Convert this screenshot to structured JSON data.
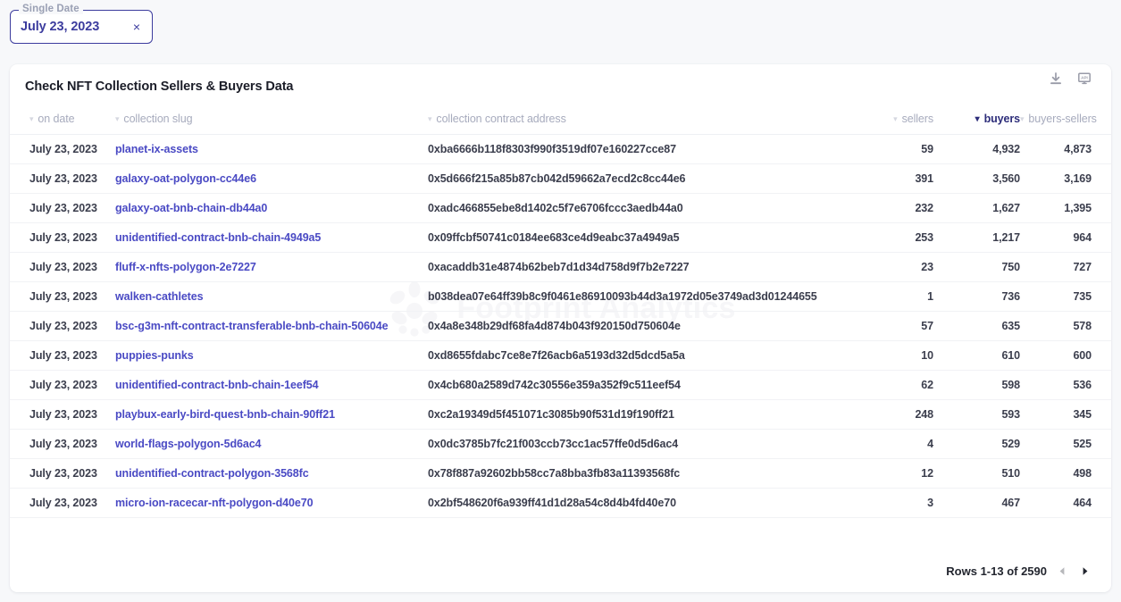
{
  "date_filter": {
    "legend": "Single Date",
    "value": "July 23, 2023",
    "clear_label": "×"
  },
  "card": {
    "title": "Check NFT Collection Sellers & Buyers Data",
    "actions": [
      {
        "name": "download-icon",
        "label": "download"
      },
      {
        "name": "api-icon",
        "label": "api"
      }
    ]
  },
  "watermark": {
    "text": "Footprint Analytics"
  },
  "table": {
    "columns": [
      {
        "key": "on_date",
        "label": "on date",
        "sorted": false
      },
      {
        "key": "collection_slug",
        "label": "collection slug",
        "sorted": false
      },
      {
        "key": "collection_contract_address",
        "label": "collection contract address",
        "sorted": false
      },
      {
        "key": "sellers",
        "label": "sellers",
        "sorted": false
      },
      {
        "key": "buyers",
        "label": "buyers",
        "sorted": true
      },
      {
        "key": "buyers_sellers",
        "label": "buyers-sellers",
        "sorted": false
      }
    ],
    "rows": [
      {
        "on_date": "July 23, 2023",
        "slug": "planet-ix-assets",
        "address": "0xba6666b118f8303f990f3519df07e160227cce87",
        "sellers": "59",
        "buyers": "4,932",
        "buyers_sellers": "4,873"
      },
      {
        "on_date": "July 23, 2023",
        "slug": "galaxy-oat-polygon-cc44e6",
        "address": "0x5d666f215a85b87cb042d59662a7ecd2c8cc44e6",
        "sellers": "391",
        "buyers": "3,560",
        "buyers_sellers": "3,169"
      },
      {
        "on_date": "July 23, 2023",
        "slug": "galaxy-oat-bnb-chain-db44a0",
        "address": "0xadc466855ebe8d1402c5f7e6706fccc3aedb44a0",
        "sellers": "232",
        "buyers": "1,627",
        "buyers_sellers": "1,395"
      },
      {
        "on_date": "July 23, 2023",
        "slug": "unidentified-contract-bnb-chain-4949a5",
        "address": "0x09ffcbf50741c0184ee683ce4d9eabc37a4949a5",
        "sellers": "253",
        "buyers": "1,217",
        "buyers_sellers": "964"
      },
      {
        "on_date": "July 23, 2023",
        "slug": "fluff-x-nfts-polygon-2e7227",
        "address": "0xacaddb31e4874b62beb7d1d34d758d9f7b2e7227",
        "sellers": "23",
        "buyers": "750",
        "buyers_sellers": "727"
      },
      {
        "on_date": "July 23, 2023",
        "slug": "walken-cathletes",
        "address": "b038dea07e64ff39b8c9f0461e86910093b44d3a1972d05e3749ad3d01244655",
        "sellers": "1",
        "buyers": "736",
        "buyers_sellers": "735"
      },
      {
        "on_date": "July 23, 2023",
        "slug": "bsc-g3m-nft-contract-transferable-bnb-chain-50604e",
        "address": "0x4a8e348b29df68fa4d874b043f920150d750604e",
        "sellers": "57",
        "buyers": "635",
        "buyers_sellers": "578"
      },
      {
        "on_date": "July 23, 2023",
        "slug": "puppies-punks",
        "address": "0xd8655fdabc7ce8e7f26acb6a5193d32d5dcd5a5a",
        "sellers": "10",
        "buyers": "610",
        "buyers_sellers": "600"
      },
      {
        "on_date": "July 23, 2023",
        "slug": "unidentified-contract-bnb-chain-1eef54",
        "address": "0x4cb680a2589d742c30556e359a352f9c511eef54",
        "sellers": "62",
        "buyers": "598",
        "buyers_sellers": "536"
      },
      {
        "on_date": "July 23, 2023",
        "slug": "playbux-early-bird-quest-bnb-chain-90ff21",
        "address": "0xc2a19349d5f451071c3085b90f531d19f190ff21",
        "sellers": "248",
        "buyers": "593",
        "buyers_sellers": "345"
      },
      {
        "on_date": "July 23, 2023",
        "slug": "world-flags-polygon-5d6ac4",
        "address": "0x0dc3785b7fc21f003ccb73cc1ac57ffe0d5d6ac4",
        "sellers": "4",
        "buyers": "529",
        "buyers_sellers": "525"
      },
      {
        "on_date": "July 23, 2023",
        "slug": "unidentified-contract-polygon-3568fc",
        "address": "0x78f887a92602bb58cc7a8bba3fb83a11393568fc",
        "sellers": "12",
        "buyers": "510",
        "buyers_sellers": "498"
      },
      {
        "on_date": "July 23, 2023",
        "slug": "micro-ion-racecar-nft-polygon-d40e70",
        "address": "0x2bf548620f6a939ff41d1d28a54c8d4b4fd40e70",
        "sellers": "3",
        "buyers": "467",
        "buyers_sellers": "464"
      }
    ]
  },
  "pagination": {
    "label": "Rows 1-13 of 2590",
    "prev_enabled": false,
    "next_enabled": true
  },
  "colors": {
    "accent": "#3c3c9e",
    "link": "#4a4ac4",
    "muted": "#a7abbd",
    "page_bg": "#f7f8fa"
  }
}
